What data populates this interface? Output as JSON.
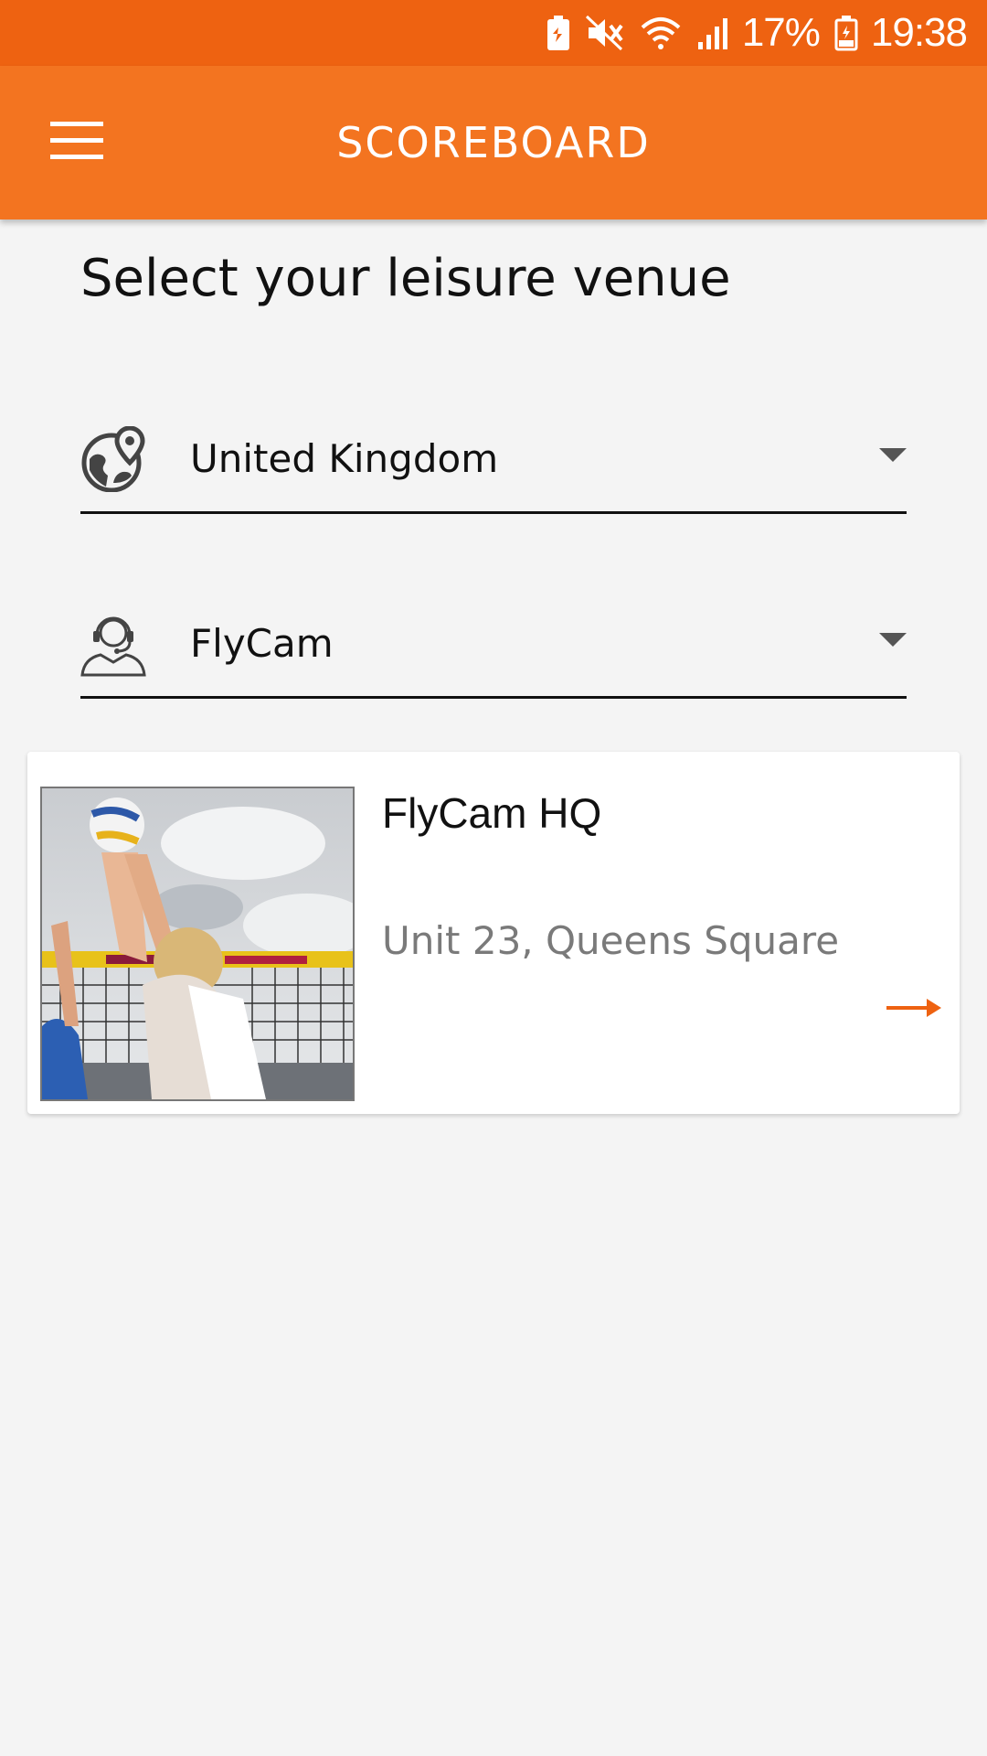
{
  "status_bar": {
    "battery_percent": "17%",
    "time": "19:38",
    "icons": [
      "battery-saver-icon",
      "mute-icon",
      "wifi-icon",
      "signal-icon",
      "battery-icon"
    ]
  },
  "app_bar": {
    "title": "SCOREBOARD",
    "menu_icon": "hamburger-menu-icon"
  },
  "page": {
    "heading": "Select your leisure venue"
  },
  "country_dropdown": {
    "icon": "globe-location-icon",
    "value": "United Kingdom"
  },
  "operator_dropdown": {
    "icon": "operator-headset-icon",
    "value": "FlyCam"
  },
  "venues": [
    {
      "name": "FlyCam HQ",
      "address": "Unit 23, Queens Square",
      "image": "beach-volleyball-photo",
      "action_icon": "arrow-right-icon"
    }
  ],
  "colors": {
    "status_bar": "#ee6211",
    "app_bar": "#f37420",
    "accent": "#ee6211",
    "background": "#f4f4f4"
  }
}
